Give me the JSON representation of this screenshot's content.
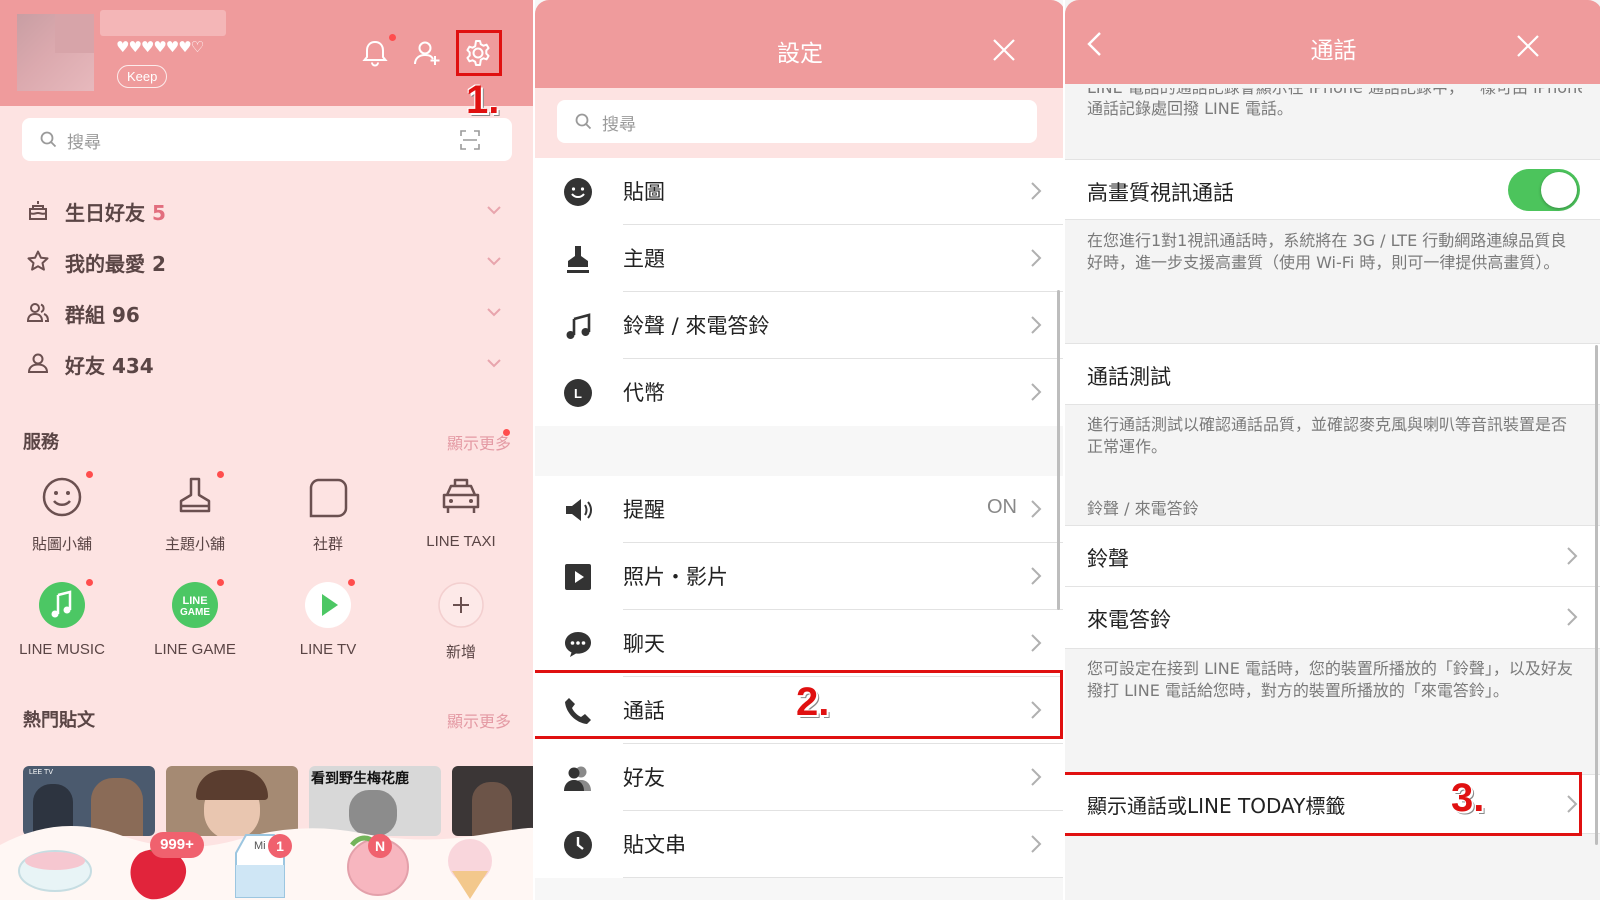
{
  "colors": {
    "header_pink": "#ef9b9c",
    "bg_pink": "#fde3e2",
    "accent_red": "#e01010",
    "toggle_green": "#4cc45c",
    "badge_red": "#f0616e"
  },
  "home": {
    "status_hearts": "♥♥♥♥♥♥♡",
    "keep_label": "Keep",
    "step1": "1.",
    "search_placeholder": "搜尋",
    "friend_groups": [
      {
        "label": "生日好友",
        "count": "5",
        "icon": "cake-icon"
      },
      {
        "label": "我的最愛",
        "count": "2",
        "icon": "star-icon"
      },
      {
        "label": "群組",
        "count": "96",
        "icon": "group-icon"
      },
      {
        "label": "好友",
        "count": "434",
        "icon": "person-icon"
      }
    ],
    "services_title": "服務",
    "services_more": "顯示更多",
    "services": [
      {
        "label": "貼圖小舖",
        "icon": "smiley-icon"
      },
      {
        "label": "主題小舖",
        "icon": "theme-brush-icon"
      },
      {
        "label": "社群",
        "icon": "square-chat-icon"
      },
      {
        "label": "LINE TAXI",
        "icon": "taxi-icon"
      },
      {
        "label": "LINE MUSIC",
        "icon": "line-music-icon"
      },
      {
        "label": "LINE GAME",
        "icon": "line-game-icon"
      },
      {
        "label": "LINE TV",
        "icon": "line-tv-icon"
      },
      {
        "label": "新增",
        "icon": "plus-icon"
      }
    ],
    "game_icon_text": [
      "LINE",
      "GAME"
    ],
    "hot_posts_title": "熱門貼文",
    "hot_posts_more": "顯示更多",
    "thumb_caption": "看到野生梅花鹿",
    "thumb_tag": "LEE TV",
    "badge_chats": "999+",
    "badge_milk": "1",
    "badge_news": "N",
    "milk_label": "Mi"
  },
  "settings": {
    "title": "設定",
    "search_placeholder": "搜尋",
    "step2": "2.",
    "items": [
      {
        "label": "貼圖",
        "icon": "sticker-smiley-icon",
        "value": ""
      },
      {
        "label": "主題",
        "icon": "theme-brush-icon",
        "value": ""
      },
      {
        "label": "鈴聲 / 來電答鈴",
        "icon": "music-note-icon",
        "value": ""
      },
      {
        "label": "代幣",
        "icon": "coin-icon",
        "value": ""
      },
      {
        "label": "提醒",
        "icon": "speaker-icon",
        "value": "ON"
      },
      {
        "label": "照片・影片",
        "icon": "play-icon",
        "value": ""
      },
      {
        "label": "聊天",
        "icon": "chat-bubble-icon",
        "value": ""
      },
      {
        "label": "通話",
        "icon": "phone-icon",
        "value": ""
      },
      {
        "label": "好友",
        "icon": "friends-icon",
        "value": ""
      },
      {
        "label": "貼文串",
        "icon": "clock-icon",
        "value": ""
      }
    ],
    "coin_letter": "L"
  },
  "calls": {
    "title": "通話",
    "cut_text_line1": "LINE 電話的通話記錄會顯示在 iPhone 通話記錄中，一樣可由 iPhone",
    "cut_text_line2": "通話記錄處回撥 LINE 電話。",
    "hd_video_label": "高畫質視訊通話",
    "hd_video_on": true,
    "hd_video_desc": "在您進行1對1視訊通話時，系統將在 3G / LTE 行動網路連線品質良好時，進一步支援高畫質（使用 Wi-Fi 時，則可一律提供高畫質）。",
    "call_test_label": "通話測試",
    "call_test_desc": "進行通話測試以確認通話品質，並確認麥克風與喇叭等音訊裝置是否正常運作。",
    "ring_section": "鈴聲 / 來電答鈴",
    "ringtone_label": "鈴聲",
    "ringback_label": "來電答鈴",
    "ring_desc": "您可設定在接到 LINE 電話時，您的裝置所播放的「鈴聲」，以及好友撥打 LINE 電話給您時，對方的裝置所播放的「來電答鈴」。",
    "today_tab_label": "顯示通話或LINE TODAY標籤",
    "step3": "3."
  }
}
